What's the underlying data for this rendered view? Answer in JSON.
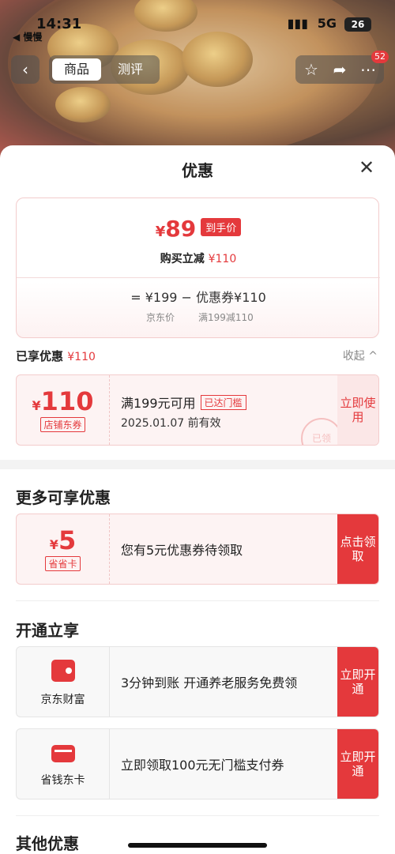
{
  "status_bar": {
    "time": "14:31",
    "carrier": "慢慢",
    "network": "5G",
    "battery": "26"
  },
  "nav": {
    "back_icon": "back-arrow-icon",
    "tabs": [
      {
        "label": "商品",
        "active": true
      },
      {
        "label": "测评",
        "active": false
      }
    ],
    "favorite_icon": "star-icon",
    "share_icon": "share-icon",
    "more_icon": "more-icon",
    "badge_count": "52"
  },
  "sheet": {
    "title": "优惠",
    "close_icon": "close-icon",
    "price_card": {
      "yen": "¥",
      "final_price": "89",
      "final_tag": "到手价",
      "subtitle": "购买立减",
      "subtitle_amount": "¥110",
      "formula": "= ¥199 − 优惠券¥110",
      "label_original": "京东价",
      "label_coupon": "满199减110"
    },
    "enjoyed": {
      "label": "已享优惠",
      "amount": "¥110",
      "collapse": "收起 ^"
    },
    "store_coupon": {
      "yen": "¥",
      "amount": "110",
      "type": "店铺东券",
      "condition": "满199元可用",
      "threshold_tag": "已达门槛",
      "validity": "2025.01.07 前有效",
      "action": "立即使用",
      "stamp": "已领"
    },
    "more_section": {
      "title": "更多可享优惠",
      "card": {
        "yen": "¥",
        "amount": "5",
        "type": "省省卡",
        "text": "您有5元优惠券待领取",
        "action": "点击领取"
      }
    },
    "open_section": {
      "title": "开通立享",
      "items": [
        {
          "icon": "wallet-icon",
          "name": "京东财富",
          "text": "3分钟到账 开通养老服务免费领",
          "action": "立即开通"
        },
        {
          "icon": "card-icon",
          "name": "省钱东卡",
          "text": "立即领取100元无门槛支付券",
          "action": "立即开通"
        }
      ]
    },
    "other_section": {
      "title": "其他优惠"
    }
  },
  "colors": {
    "accent": "#e4393c",
    "card_bg": "#fdf3f3",
    "gray_bg": "#f3f3f3"
  }
}
